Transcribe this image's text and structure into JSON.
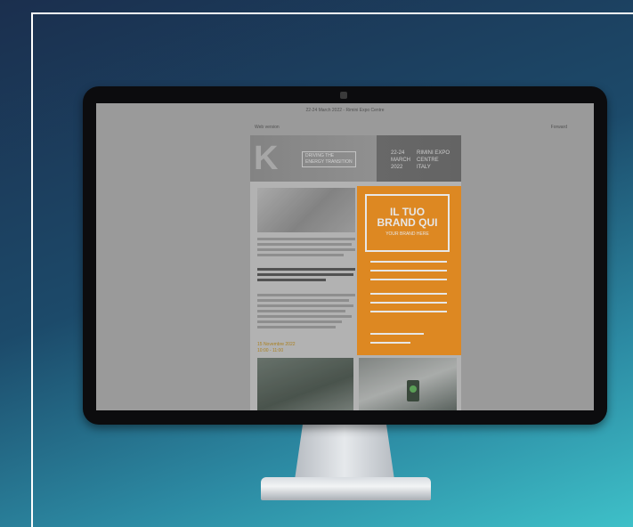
{
  "screen": {
    "top_line": "22-24 March 2022 - Rimini Expo Centre",
    "left_link": "Web version",
    "right_link": "Forward"
  },
  "hero": {
    "logo_letter": "K",
    "tagline_1": "DRIVING THE",
    "tagline_2": "ENERGY TRANSITION",
    "date_line_1": "22-24",
    "date_line_2": "MARCH",
    "date_line_3": "2022",
    "venue_line_1": "RIMINI EXPO",
    "venue_line_2": "CENTRE",
    "venue_line_3": "ITALY"
  },
  "article": {
    "date": "15 Novembre 2022",
    "time": "10:00 - 11:00"
  },
  "brand_box": {
    "title_line_1": "IL TUO",
    "title_line_2": "BRAND QUI",
    "subtitle": "YOUR BRAND HERE",
    "background_color": "#f4931f"
  }
}
